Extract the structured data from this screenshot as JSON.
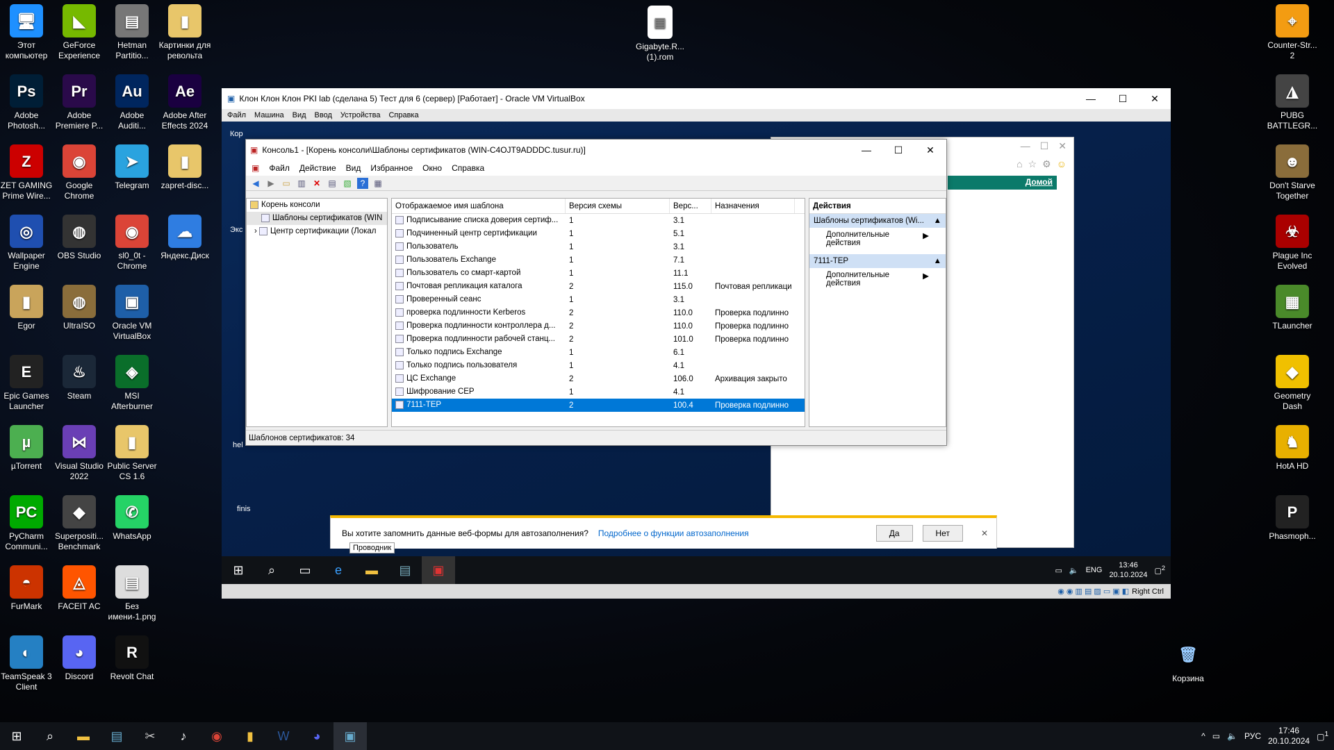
{
  "desktop": {
    "icons_left": [
      {
        "label": "Этот компьютер",
        "color": "#1e90ff",
        "glyph": "🖥"
      },
      {
        "label": "GeForce Experience",
        "color": "#76b900",
        "glyph": "◣"
      },
      {
        "label": "Hetman Partitio...",
        "color": "#777",
        "glyph": "▤"
      },
      {
        "label": "Картинки для револьта",
        "color": "#e8c66a",
        "glyph": "▮"
      },
      {
        "label": "Adobe Photosh...",
        "color": "#001e36",
        "glyph": "Ps"
      },
      {
        "label": "Adobe Premiere P...",
        "color": "#2a0a4a",
        "glyph": "Pr"
      },
      {
        "label": "Adobe Auditi...",
        "color": "#00265e",
        "glyph": "Au"
      },
      {
        "label": "Adobe After Effects 2024",
        "color": "#1a0040",
        "glyph": "Ae"
      },
      {
        "label": "ZET GAMING Prime Wire...",
        "color": "#c00",
        "glyph": "Z"
      },
      {
        "label": "Google Chrome",
        "color": "#db4437",
        "glyph": "◉"
      },
      {
        "label": "Telegram",
        "color": "#2aa3df",
        "glyph": "➤"
      },
      {
        "label": "zapret-disc...",
        "color": "#e8c66a",
        "glyph": "▮"
      },
      {
        "label": "Wallpaper Engine",
        "color": "#1f4fb0",
        "glyph": "◎"
      },
      {
        "label": "OBS Studio",
        "color": "#333",
        "glyph": "◍"
      },
      {
        "label": "sl0_0t - Chrome",
        "color": "#db4437",
        "glyph": "◉"
      },
      {
        "label": "Яндекс.Диск",
        "color": "#2f7de1",
        "glyph": "☁"
      },
      {
        "label": "Egor",
        "color": "#c9a45b",
        "glyph": "▮"
      },
      {
        "label": "UltraISO",
        "color": "#8a6d3b",
        "glyph": "◍"
      },
      {
        "label": "Oracle VM VirtualBox",
        "color": "#1e5fa8",
        "glyph": "▣"
      },
      {
        "label": "Epic Games Launcher",
        "color": "#222",
        "glyph": "E"
      },
      {
        "label": "Steam",
        "color": "#1b2838",
        "glyph": "♨"
      },
      {
        "label": "MSI Afterburner",
        "color": "#0a6e2a",
        "glyph": "◈"
      },
      {
        "label": "µTorrent",
        "color": "#4caf50",
        "glyph": "µ"
      },
      {
        "label": "Visual Studio 2022",
        "color": "#6a3fb5",
        "glyph": "⋈"
      },
      {
        "label": "Public Server CS 1.6",
        "color": "#e8c66a",
        "glyph": "▮"
      },
      {
        "label": "PyCharm Communi...",
        "color": "#0a0",
        "glyph": "PC"
      },
      {
        "label": "Superpositi... Benchmark",
        "color": "#444",
        "glyph": "◆"
      },
      {
        "label": "WhatsApp",
        "color": "#25d366",
        "glyph": "✆"
      },
      {
        "label": "FurMark",
        "color": "#c30",
        "glyph": "◓"
      },
      {
        "label": "FACEIT AC",
        "color": "#f50",
        "glyph": "◬"
      },
      {
        "label": "Без имени-1.png",
        "color": "#ddd",
        "glyph": "▤"
      },
      {
        "label": "TeamSpeak 3 Client",
        "color": "#2580c3",
        "glyph": "◐"
      },
      {
        "label": "Discord",
        "color": "#5865f2",
        "glyph": "◕"
      },
      {
        "label": "Revolt Chat",
        "color": "#111",
        "glyph": "R"
      }
    ],
    "icons_right": [
      {
        "label": "Counter-Str... 2",
        "color": "#f39c12",
        "glyph": "⌖"
      },
      {
        "label": "PUBG BATTLEGR...",
        "color": "#444",
        "glyph": "◮"
      },
      {
        "label": "Don't Starve Together",
        "color": "#8a6d3b",
        "glyph": "☻"
      },
      {
        "label": "Plague Inc Evolved",
        "color": "#a00",
        "glyph": "☣"
      },
      {
        "label": "TLauncher",
        "color": "#4a8a2a",
        "glyph": "▦"
      },
      {
        "label": "Geometry Dash",
        "color": "#f0c000",
        "glyph": "◆"
      },
      {
        "label": "HotA HD",
        "color": "#e8b000",
        "glyph": "♞"
      },
      {
        "label": "Phasmoph...",
        "color": "#222",
        "glyph": "P"
      }
    ],
    "file_icon_label": "Gigabyte.R... (1).rom",
    "recycle_label": "Корзина"
  },
  "vm": {
    "title": "Клон Клон Клон PKI lab (сделана 5) Тест для 6 (сервер) [Работает] - Oracle VM VirtualBox",
    "menu": [
      "Файл",
      "Машина",
      "Вид",
      "Ввод",
      "Устройства",
      "Справка"
    ],
    "status_host_key": "Right Ctrl"
  },
  "mmc": {
    "title": "Консоль1 - [Корень консоли\\Шаблоны сертификатов (WIN-C4OJT9ADDDC.tusur.ru)]",
    "menu": [
      "Файл",
      "Действие",
      "Вид",
      "Избранное",
      "Окно",
      "Справка"
    ],
    "tree": [
      "Корень консоли",
      "Шаблоны сертификатов (WIN",
      "Центр сертификации (Локал"
    ],
    "columns": [
      "Отображаемое имя шаблона",
      "Версия схемы",
      "Верс...",
      "Назначения"
    ],
    "rows": [
      [
        "Подписывание списка доверия сертиф...",
        "1",
        "3.1",
        ""
      ],
      [
        "Подчиненный центр сертификации",
        "1",
        "5.1",
        ""
      ],
      [
        "Пользователь",
        "1",
        "3.1",
        ""
      ],
      [
        "Пользователь Exchange",
        "1",
        "7.1",
        ""
      ],
      [
        "Пользователь со смарт-картой",
        "1",
        "11.1",
        ""
      ],
      [
        "Почтовая репликация каталога",
        "2",
        "115.0",
        "Почтовая репликаци"
      ],
      [
        "Проверенный сеанс",
        "1",
        "3.1",
        ""
      ],
      [
        "проверка подлинности Kerberos",
        "2",
        "110.0",
        "Проверка подлинно"
      ],
      [
        "Проверка подлинности контроллера д...",
        "2",
        "110.0",
        "Проверка подлинно"
      ],
      [
        "Проверка подлинности рабочей станц...",
        "2",
        "101.0",
        "Проверка подлинно"
      ],
      [
        "Только подпись Exchange",
        "1",
        "6.1",
        ""
      ],
      [
        "Только подпись пользователя",
        "1",
        "4.1",
        ""
      ],
      [
        "ЦС Exchange",
        "2",
        "106.0",
        "Архивация закрыто"
      ],
      [
        "Шифрование CEP",
        "1",
        "4.1",
        ""
      ],
      [
        "7111-ТЕР",
        "2",
        "100.4",
        "Проверка подлинно"
      ]
    ],
    "actions_title": "Действия",
    "actions": [
      {
        "header": "Шаблоны сертификатов (Wi...",
        "item": "Дополнительные действия"
      },
      {
        "header": "7111-ТЕР",
        "item": "Дополнительные действия"
      }
    ],
    "status": "Шаблонов сертификатов: 34"
  },
  "ie": {
    "home_link": "Домой"
  },
  "autofill": {
    "question": "Вы хотите запомнить данные веб-формы для автозаполнения?",
    "link": "Подробнее о функции автозаполнения",
    "yes": "Да",
    "no": "Нет",
    "tooltip": "Проводник"
  },
  "guest_taskbar": {
    "lang": "ENG",
    "time": "13:46",
    "date": "20.10.2024",
    "badge": "2"
  },
  "guest_desktop_labels": [
    "Кор",
    "Экс",
    "hel",
    "finis"
  ],
  "taskbar": {
    "lang": "РУС",
    "time": "17:46",
    "date": "20.10.2024",
    "badge": "1"
  }
}
